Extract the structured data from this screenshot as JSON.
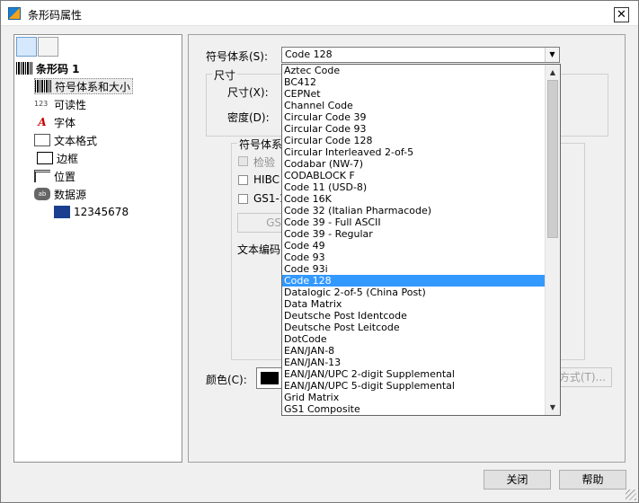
{
  "window": {
    "title": "条形码属性",
    "close_glyph": "✕"
  },
  "tree": {
    "root": "条形码 1",
    "items": [
      {
        "label": "符号体系和大小",
        "icon": "barcode-icon"
      },
      {
        "label": "可读性",
        "icon": "readability-icon",
        "prefix": "123"
      },
      {
        "label": "字体",
        "icon": "font-icon",
        "glyph": "A"
      },
      {
        "label": "文本格式",
        "icon": "text-format-icon"
      },
      {
        "label": "边框",
        "icon": "border-icon"
      },
      {
        "label": "位置",
        "icon": "position-icon"
      },
      {
        "label": "数据源",
        "icon": "datasource-icon",
        "glyph": "ab"
      }
    ],
    "child": "12345678"
  },
  "form": {
    "symbology_label": "符号体系(S):",
    "symbology_value": "Code 128",
    "size_group_title": "尺寸",
    "size_label": "尺寸(X):",
    "density_label": "密度(D):",
    "symbology_group_title": "符号体系",
    "check_label": "检验",
    "hibc_label": "HIBC",
    "gs1_label": "GS1-1",
    "gs_button": "GS",
    "encoding_label": "文本编码",
    "color_label": "颜色(C):",
    "format_button": "方式(T)..."
  },
  "dropdown": {
    "items": [
      "Aztec Code",
      "BC412",
      "CEPNet",
      "Channel Code",
      "Circular Code 39",
      "Circular Code 93",
      "Circular Code 128",
      "Circular Interleaved 2-of-5",
      "Codabar (NW-7)",
      "CODABLOCK F",
      "Code 11 (USD-8)",
      "Code 16K",
      "Code 32 (Italian Pharmacode)",
      "Code 39 - Full ASCII",
      "Code 39 - Regular",
      "Code 49",
      "Code 93",
      "Code 93i",
      "Code 128",
      "Datalogic 2-of-5 (China Post)",
      "Data Matrix",
      "Deutsche Post Identcode",
      "Deutsche Post Leitcode",
      "DotCode",
      "EAN/JAN-8",
      "EAN/JAN-13",
      "EAN/JAN/UPC 2-digit Supplemental",
      "EAN/JAN/UPC 5-digit Supplemental",
      "Grid Matrix",
      "GS1 Composite"
    ],
    "selected": 18,
    "up_arrow": "▲",
    "down_arrow": "▼"
  },
  "buttons": {
    "close": "关闭",
    "help": "帮助"
  },
  "colors": {
    "selection": "#3399ff",
    "swatch": "#000000"
  }
}
